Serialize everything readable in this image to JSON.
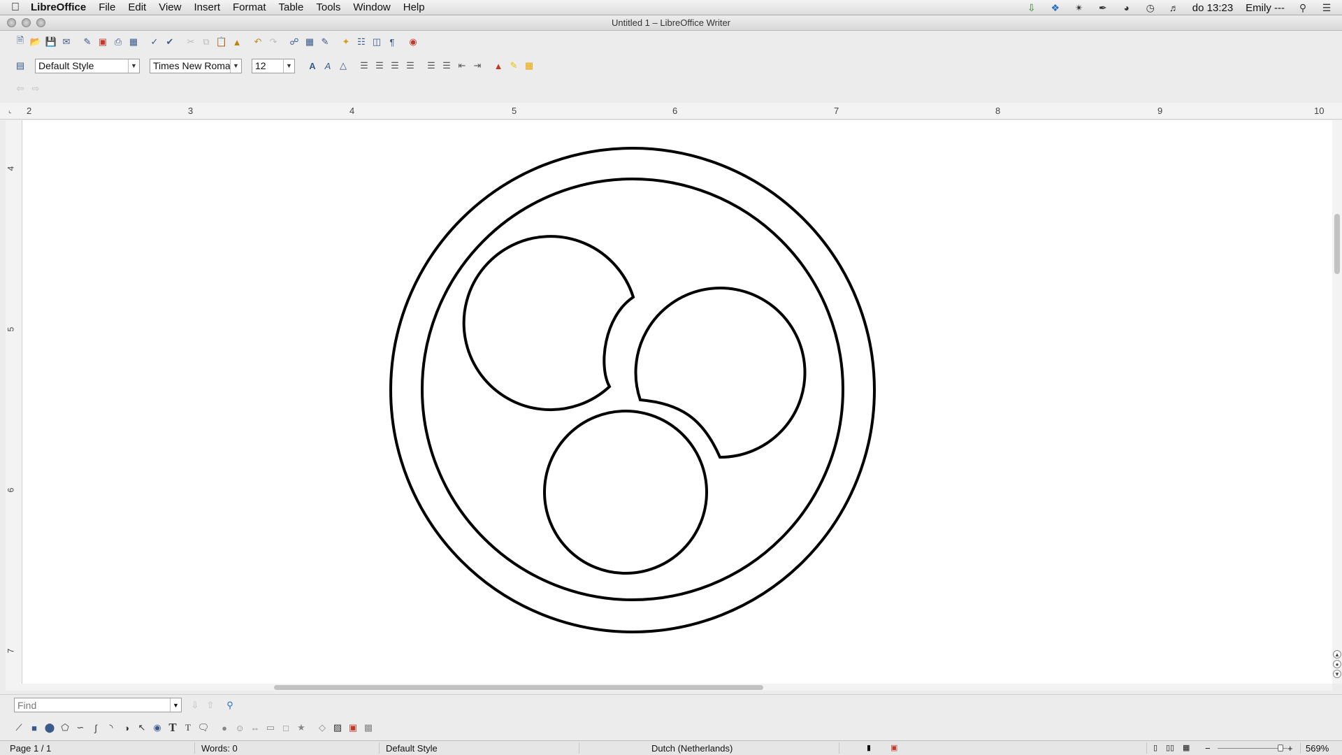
{
  "menubar": {
    "app_name": "LibreOffice",
    "items": [
      "File",
      "Edit",
      "View",
      "Insert",
      "Format",
      "Table",
      "Tools",
      "Window",
      "Help"
    ],
    "clock": "do 13:23",
    "user": "Emily ---"
  },
  "window": {
    "title": "Untitled 1 – LibreOffice Writer"
  },
  "formatting": {
    "paragraph_style": "Default Style",
    "font_name": "Times New Roman",
    "font_size": "12"
  },
  "ruler": {
    "h_ticks": [
      "2",
      "3",
      "4",
      "5",
      "6",
      "7",
      "8",
      "9",
      "10"
    ],
    "v_ticks": [
      "4",
      "5",
      "6",
      "7"
    ]
  },
  "find": {
    "placeholder": "Find"
  },
  "status": {
    "page": "Page 1 / 1",
    "words": "Words: 0",
    "style": "Default Style",
    "language": "Dutch (Netherlands)",
    "zoom": "569%"
  }
}
